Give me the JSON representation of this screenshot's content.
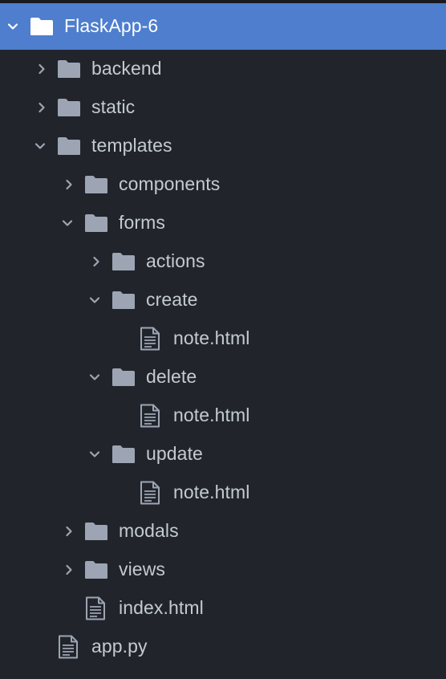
{
  "tree": {
    "root": {
      "label": "FlaskApp-6",
      "icon": "folder-icon",
      "expanded": true,
      "selected": true
    },
    "items": [
      {
        "label": "backend",
        "type": "folder",
        "expanded": false,
        "depth": 1
      },
      {
        "label": "static",
        "type": "folder",
        "expanded": false,
        "depth": 1
      },
      {
        "label": "templates",
        "type": "folder",
        "expanded": true,
        "depth": 1
      },
      {
        "label": "components",
        "type": "folder",
        "expanded": false,
        "depth": 2
      },
      {
        "label": "forms",
        "type": "folder",
        "expanded": true,
        "depth": 2
      },
      {
        "label": "actions",
        "type": "folder",
        "expanded": false,
        "depth": 3
      },
      {
        "label": "create",
        "type": "folder",
        "expanded": true,
        "depth": 3
      },
      {
        "label": "note.html",
        "type": "file",
        "depth": 4
      },
      {
        "label": "delete",
        "type": "folder",
        "expanded": true,
        "depth": 3
      },
      {
        "label": "note.html",
        "type": "file",
        "depth": 4
      },
      {
        "label": "update",
        "type": "folder",
        "expanded": true,
        "depth": 3
      },
      {
        "label": "note.html",
        "type": "file",
        "depth": 4
      },
      {
        "label": "modals",
        "type": "folder",
        "expanded": false,
        "depth": 2
      },
      {
        "label": "views",
        "type": "folder",
        "expanded": false,
        "depth": 2
      },
      {
        "label": "index.html",
        "type": "file",
        "depth": 2
      },
      {
        "label": "app.py",
        "type": "file",
        "depth": 1
      }
    ]
  },
  "colors": {
    "background": "#21252b",
    "selected_row": "#4e7ecd",
    "text": "#c4cad3",
    "icon": "#9da5b4"
  }
}
